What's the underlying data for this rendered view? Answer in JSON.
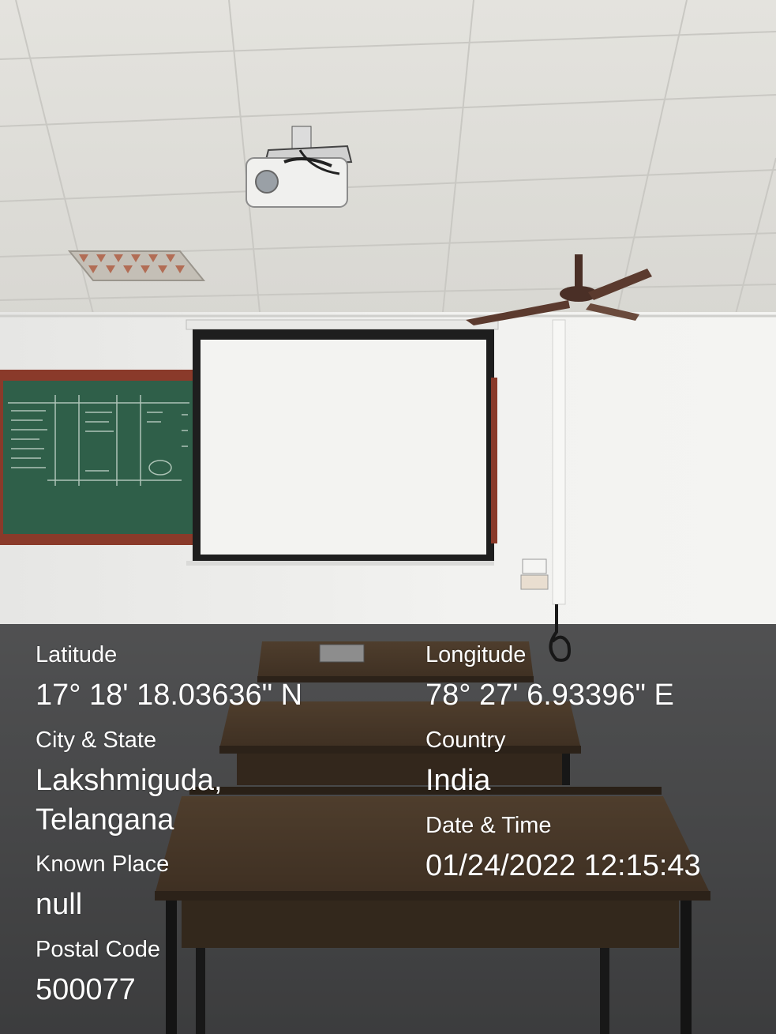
{
  "photo": {
    "subject": "classroom-with-projector-screen",
    "colors": {
      "ceiling": "#e9e8e3",
      "wall": "#eeeeec",
      "chalkboard": "#2f5f49",
      "chalkboard_frame": "#8a3a2a",
      "screen": "#f3f3f1",
      "screen_border": "#1e1e1e",
      "desk_top": "#6d5238",
      "floor": "#6c6d6f"
    }
  },
  "geo_tag": {
    "latitude": {
      "label": "Latitude",
      "value": "17° 18' 18.03636\" N"
    },
    "longitude": {
      "label": "Longitude",
      "value": "78° 27' 6.93396\" E"
    },
    "city_state": {
      "label": "City & State",
      "value_line1": "Lakshmiguda,",
      "value_line2": "Telangana"
    },
    "country": {
      "label": "Country",
      "value": "India"
    },
    "date_time": {
      "label": "Date & Time",
      "value": "01/24/2022 12:15:43"
    },
    "known_place": {
      "label": "Known Place",
      "value": "null"
    },
    "postal_code": {
      "label": "Postal Code",
      "value": "500077"
    }
  }
}
